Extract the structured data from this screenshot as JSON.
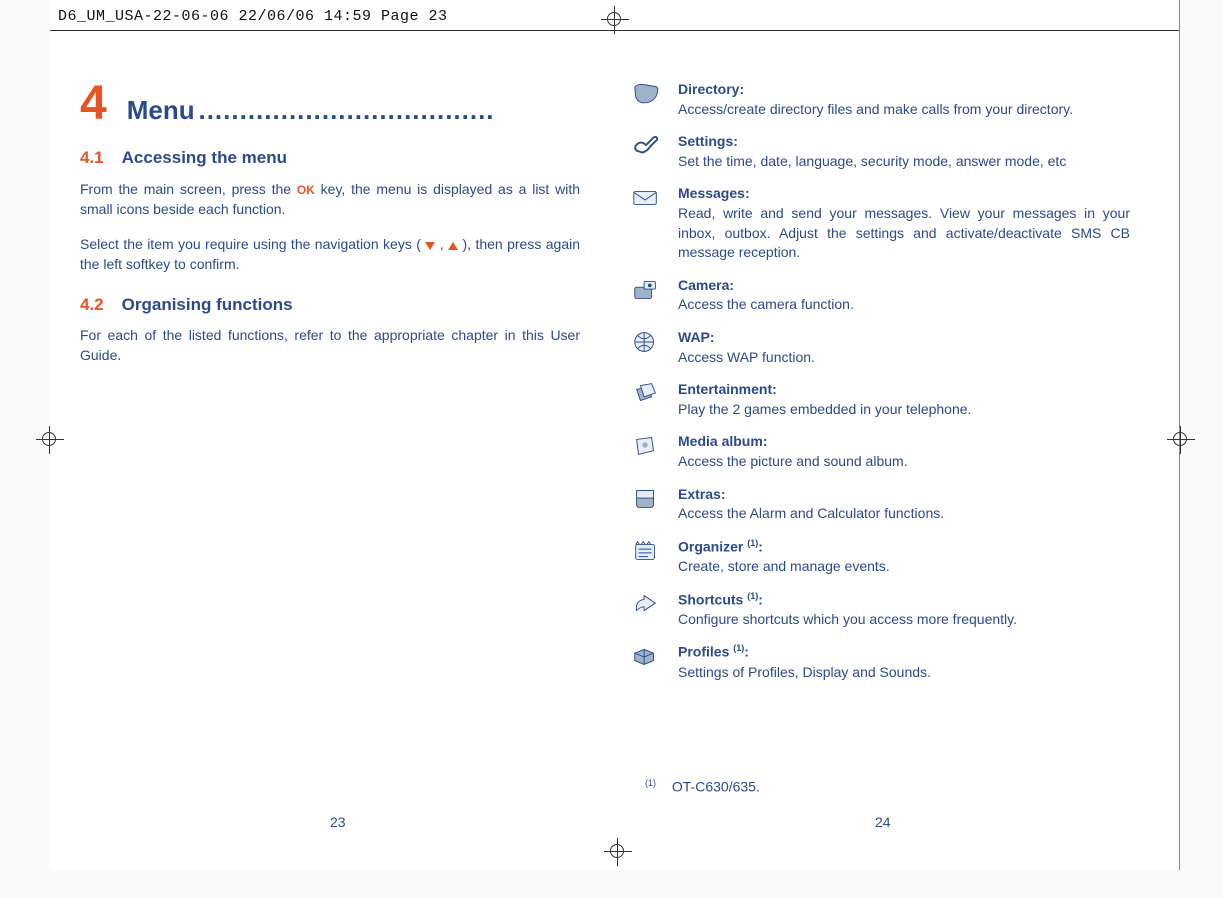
{
  "header": "D6_UM_USA-22-06-06  22/06/06  14:59  Page 23",
  "chapter": {
    "num": "4",
    "title": "Menu",
    "dots": "...................................."
  },
  "sections": {
    "s1": {
      "num": "4.1",
      "title": "Accessing the menu",
      "p1a": "From the main screen, press the ",
      "p1_ok": "OK",
      "p1b": " key, the menu is displayed as a list with small icons beside each function.",
      "p2a": "Select the item you require using the navigation keys (",
      "p2b": ", ",
      "p2c": "), then press again the left softkey to confirm."
    },
    "s2": {
      "num": "4.2",
      "title": "Organising functions",
      "p1": "For each of the listed functions, refer to the appropriate chapter in this User Guide."
    }
  },
  "functions": [
    {
      "title": "Directory",
      "colon": ":",
      "sup": "",
      "desc": "Access/create directory files and make calls from your directory.",
      "icon": "directory-icon"
    },
    {
      "title": "Settings",
      "colon": ":",
      "sup": "",
      "desc": "Set the time, date, language, security mode, answer mode, etc",
      "icon": "settings-icon"
    },
    {
      "title": "Messages",
      "colon": ":",
      "sup": "",
      "desc": "Read, write and send your messages. View your messages in your inbox, outbox. Adjust the settings and activate/deactivate SMS CB message reception.",
      "icon": "messages-icon"
    },
    {
      "title": "Camera",
      "colon": ":",
      "sup": "",
      "desc": "Access the camera function.",
      "icon": "camera-icon"
    },
    {
      "title": "WAP",
      "colon": ":",
      "sup": "",
      "desc": "Access WAP function.",
      "icon": "wap-icon"
    },
    {
      "title": "Entertainment",
      "colon": ":",
      "sup": "",
      "desc": "Play the 2 games embedded in your telephone.",
      "icon": "entertainment-icon"
    },
    {
      "title": "Media album",
      "colon": ":",
      "sup": "",
      "desc": "Access the picture and sound album.",
      "icon": "media-album-icon"
    },
    {
      "title": "Extras",
      "colon": ":",
      "sup": "",
      "desc": "Access the Alarm and Calculator functions.",
      "icon": "extras-icon"
    },
    {
      "title": "Organizer ",
      "colon": ":",
      "sup": "(1)",
      "desc": "Create, store and manage events.",
      "icon": "organizer-icon"
    },
    {
      "title": "Shortcuts ",
      "colon": ":",
      "sup": "(1)",
      "desc": "Configure shortcuts which you access more frequently.",
      "icon": "shortcuts-icon"
    },
    {
      "title": "Profiles ",
      "colon": ":",
      "sup": "(1)",
      "desc": "Settings of Profiles, Display and Sounds.",
      "icon": "profiles-icon"
    }
  ],
  "footnote": {
    "sup": "(1)",
    "text": "OT-C630/635."
  },
  "pages": {
    "left": "23",
    "right": "24"
  }
}
